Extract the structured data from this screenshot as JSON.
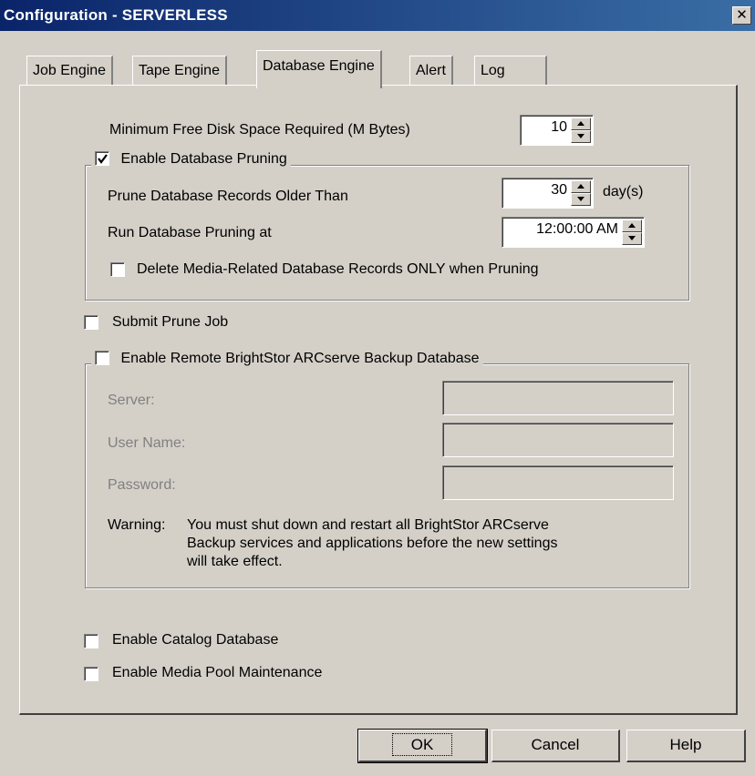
{
  "window": {
    "title": "Configuration - SERVERLESS",
    "close_glyph": "✕"
  },
  "tabs": [
    {
      "label": "Job Engine"
    },
    {
      "label": "Tape Engine"
    },
    {
      "label": "Database Engine"
    },
    {
      "label": "Alert"
    },
    {
      "label": "Log"
    }
  ],
  "disk_space": {
    "label": "Minimum Free Disk Space Required (M Bytes)",
    "value": "10"
  },
  "pruning": {
    "enable_label": "Enable Database Pruning",
    "enabled": true,
    "older_than_label": "Prune Database Records Older Than",
    "older_than_value": "30",
    "older_than_unit": "day(s)",
    "run_at_label": "Run Database Pruning at",
    "run_at_value": "12:00:00 AM",
    "media_only_label": "Delete Media-Related Database Records ONLY when Pruning",
    "media_only": false
  },
  "submit_prune": {
    "label": "Submit Prune Job",
    "checked": false
  },
  "remote_db": {
    "enable_label": "Enable Remote BrightStor ARCserve Backup Database",
    "enabled": false,
    "server_label": "Server:",
    "server_value": "",
    "user_label": "User Name:",
    "user_value": "",
    "password_label": "Password:",
    "password_value": "",
    "warning_prefix": "Warning:",
    "warning_line1": "You must shut down and restart all BrightStor ARCserve",
    "warning_line2": "Backup services and applications before the new settings",
    "warning_line3": "will take effect."
  },
  "catalog": {
    "label": "Enable Catalog Database",
    "checked": false
  },
  "media_pool": {
    "label": "Enable Media Pool Maintenance",
    "checked": false
  },
  "buttons": {
    "ok": "OK",
    "cancel": "Cancel",
    "help": "Help"
  }
}
